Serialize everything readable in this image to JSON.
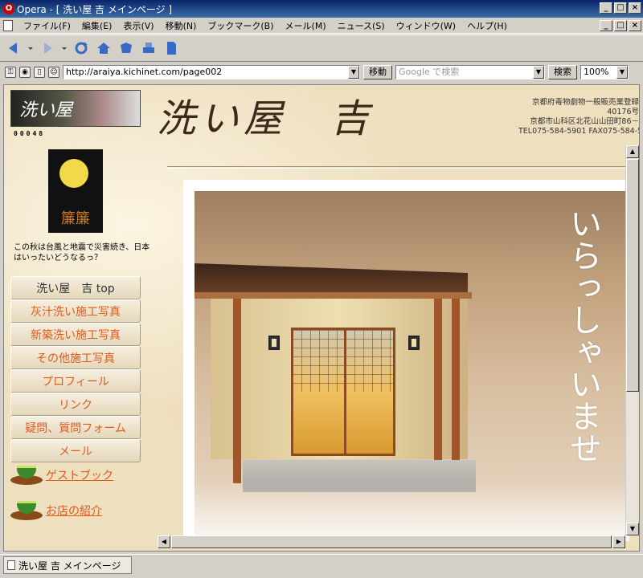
{
  "window": {
    "app_name": "Opera",
    "title": "Opera - [ 洗い屋 吉 メインページ ]",
    "controls": [
      "_",
      "□",
      "×"
    ]
  },
  "menu": [
    "ファイル(F)",
    "編集(E)",
    "表示(V)",
    "移動(N)",
    "ブックマーク(B)",
    "メール(M)",
    "ニュース(S)",
    "ウィンドウ(W)",
    "ヘルプ(H)"
  ],
  "address": {
    "url": "http://araiya.kichinet.com/page002",
    "go_label": "移動",
    "search_placeholder": "Google で検索",
    "search_label": "検索",
    "zoom": "100%"
  },
  "page": {
    "logo_text": "洗い屋",
    "counter": "00048",
    "site_title": "洗い屋　吉",
    "reg_lines": [
      "京都府毒物劇物一般販売業登録",
      "40176号",
      "京都市山科区北花山山田町86－",
      "TEL075-584-5901 FAX075-584-5"
    ],
    "banner_text": "簾簾",
    "notice": "この秋は台風と地震で災害続き、日本はいったいどうなるっ？",
    "nav": [
      {
        "label": "洗い屋　吉 top"
      },
      {
        "label": "灰汁洗い施工写真"
      },
      {
        "label": "新築洗い施工写真"
      },
      {
        "label": "その他施工写真"
      },
      {
        "label": "プロフィール"
      },
      {
        "label": "リンク"
      },
      {
        "label": "疑問、質問フォーム"
      },
      {
        "label": "メール"
      }
    ],
    "guestbook_label": "ゲストブック",
    "shop_label": "お店の紹介",
    "welcome_text": "いらっしゃいませ"
  },
  "status": {
    "tab_label": "洗い屋 吉 メインページ"
  }
}
